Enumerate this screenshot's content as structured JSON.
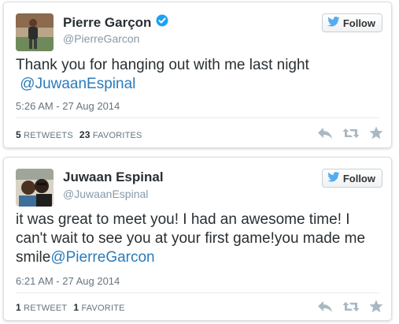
{
  "tweets": [
    {
      "name": "Pierre Garçon",
      "handle": "@PierreGarcon",
      "verified": true,
      "follow_label": "Follow",
      "text": "Thank you for hanging out with me last night",
      "mention": "@JuwaanEspinal",
      "time": "5:26 AM - 27 Aug 2014",
      "retweets_count": "5",
      "retweets_label": "Retweets",
      "favorites_count": "23",
      "favorites_label": "Favorites",
      "icons": [
        "reply-icon",
        "retweet-icon",
        "favorite-icon"
      ]
    },
    {
      "name": "Juwaan Espinal",
      "handle": "@JuwaanEspinal",
      "verified": false,
      "follow_label": "Follow",
      "text": "it was great to meet you! I had an awesome time! I can't wait to see you at your first game!you made me smile",
      "mention": "@PierreGarcon",
      "time": "6:21 AM - 27 Aug 2014",
      "retweets_count": "1",
      "retweets_label": "Retweet",
      "favorites_count": "1",
      "favorites_label": "Favorite",
      "icons": [
        "reply-icon",
        "retweet-icon",
        "favorite-icon"
      ]
    }
  ],
  "colors": {
    "link": "#2b7bb9",
    "verified": "#1da1f2",
    "bird": "#55acee",
    "muted": "#66757f",
    "icon": "#aab8c2"
  }
}
